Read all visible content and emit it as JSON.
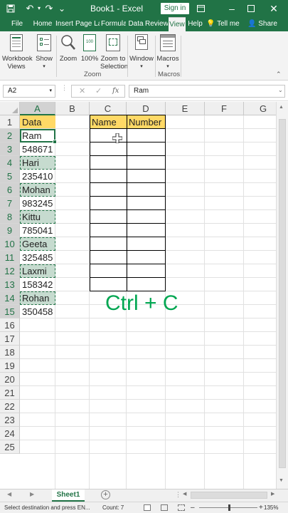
{
  "window": {
    "title": "Book1 - Excel",
    "sign_in": "Sign in",
    "accent": "#217346"
  },
  "ribbon_tabs": [
    "File",
    "Home",
    "Insert",
    "Page La",
    "Formula",
    "Data",
    "Review",
    "View",
    "Help"
  ],
  "tell_me": "Tell me",
  "share": "Share",
  "ribbon": {
    "workbook_views": "Workbook Views",
    "show": "Show",
    "zoom": "Zoom",
    "zoom_100": "100%",
    "zoom_selection": "Zoom to Selection",
    "zoom_group": "Zoom",
    "window": "Window",
    "macros": "Macros",
    "macros_group": "Macros"
  },
  "formula_bar": {
    "name_box": "A2",
    "fx": "fx",
    "value": "Ram"
  },
  "columns": [
    "A",
    "B",
    "C",
    "D",
    "E",
    "F",
    "G"
  ],
  "rows": [
    "1",
    "2",
    "3",
    "4",
    "5",
    "6",
    "7",
    "8",
    "9",
    "10",
    "11",
    "12",
    "13",
    "14",
    "15",
    "16",
    "17",
    "18",
    "19",
    "20",
    "21",
    "22",
    "23",
    "24",
    "25"
  ],
  "column_a": [
    "Data",
    "Ram",
    "548671",
    "Hari",
    "235410",
    "Mohan",
    "983245",
    "Kittu",
    "785041",
    "Geeta",
    "325485",
    "Laxmi",
    "158342",
    "Rohan",
    "350458"
  ],
  "table_headers": {
    "name": "Name",
    "number": "Number"
  },
  "overlay_text": "Ctrl + C",
  "sheet_tab": "Sheet1",
  "status": {
    "message": "Select destination and press EN...",
    "count": "Count: 7",
    "zoom": "135%"
  }
}
